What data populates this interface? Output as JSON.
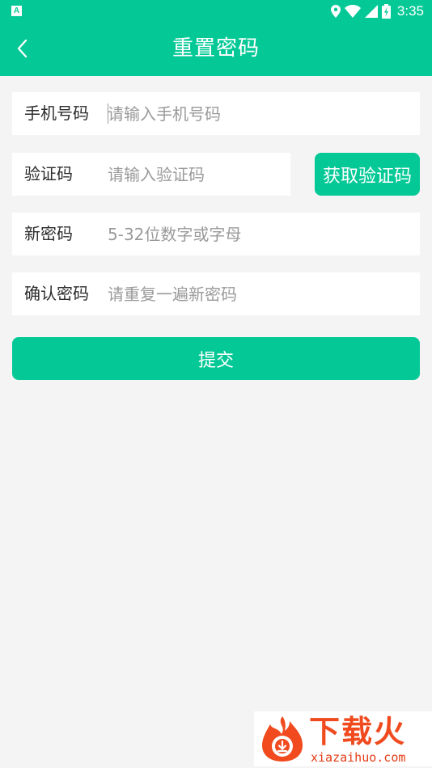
{
  "status_bar": {
    "app_icon_letter": "A",
    "time": "3:35"
  },
  "header": {
    "title": "重置密码"
  },
  "form": {
    "phone": {
      "label": "手机号码",
      "placeholder": "请输入手机号码",
      "value": ""
    },
    "code": {
      "label": "验证码",
      "placeholder": "请输入验证码",
      "value": "",
      "button_label": "获取验证码"
    },
    "new_password": {
      "label": "新密码",
      "placeholder": "5-32位数字或字母",
      "value": ""
    },
    "confirm_password": {
      "label": "确认密码",
      "placeholder": "请重复一遍新密码",
      "value": ""
    },
    "submit_label": "提交"
  },
  "watermark": {
    "brand": "下载火",
    "domain": "xiazaihuo.com"
  },
  "colors": {
    "accent": "#04c996",
    "background": "#f3f4f3",
    "watermark": "#f04a1e"
  },
  "icons": [
    "back-icon",
    "location-icon",
    "wifi-icon",
    "signal-icon",
    "battery-icon",
    "flame-logo-icon"
  ]
}
